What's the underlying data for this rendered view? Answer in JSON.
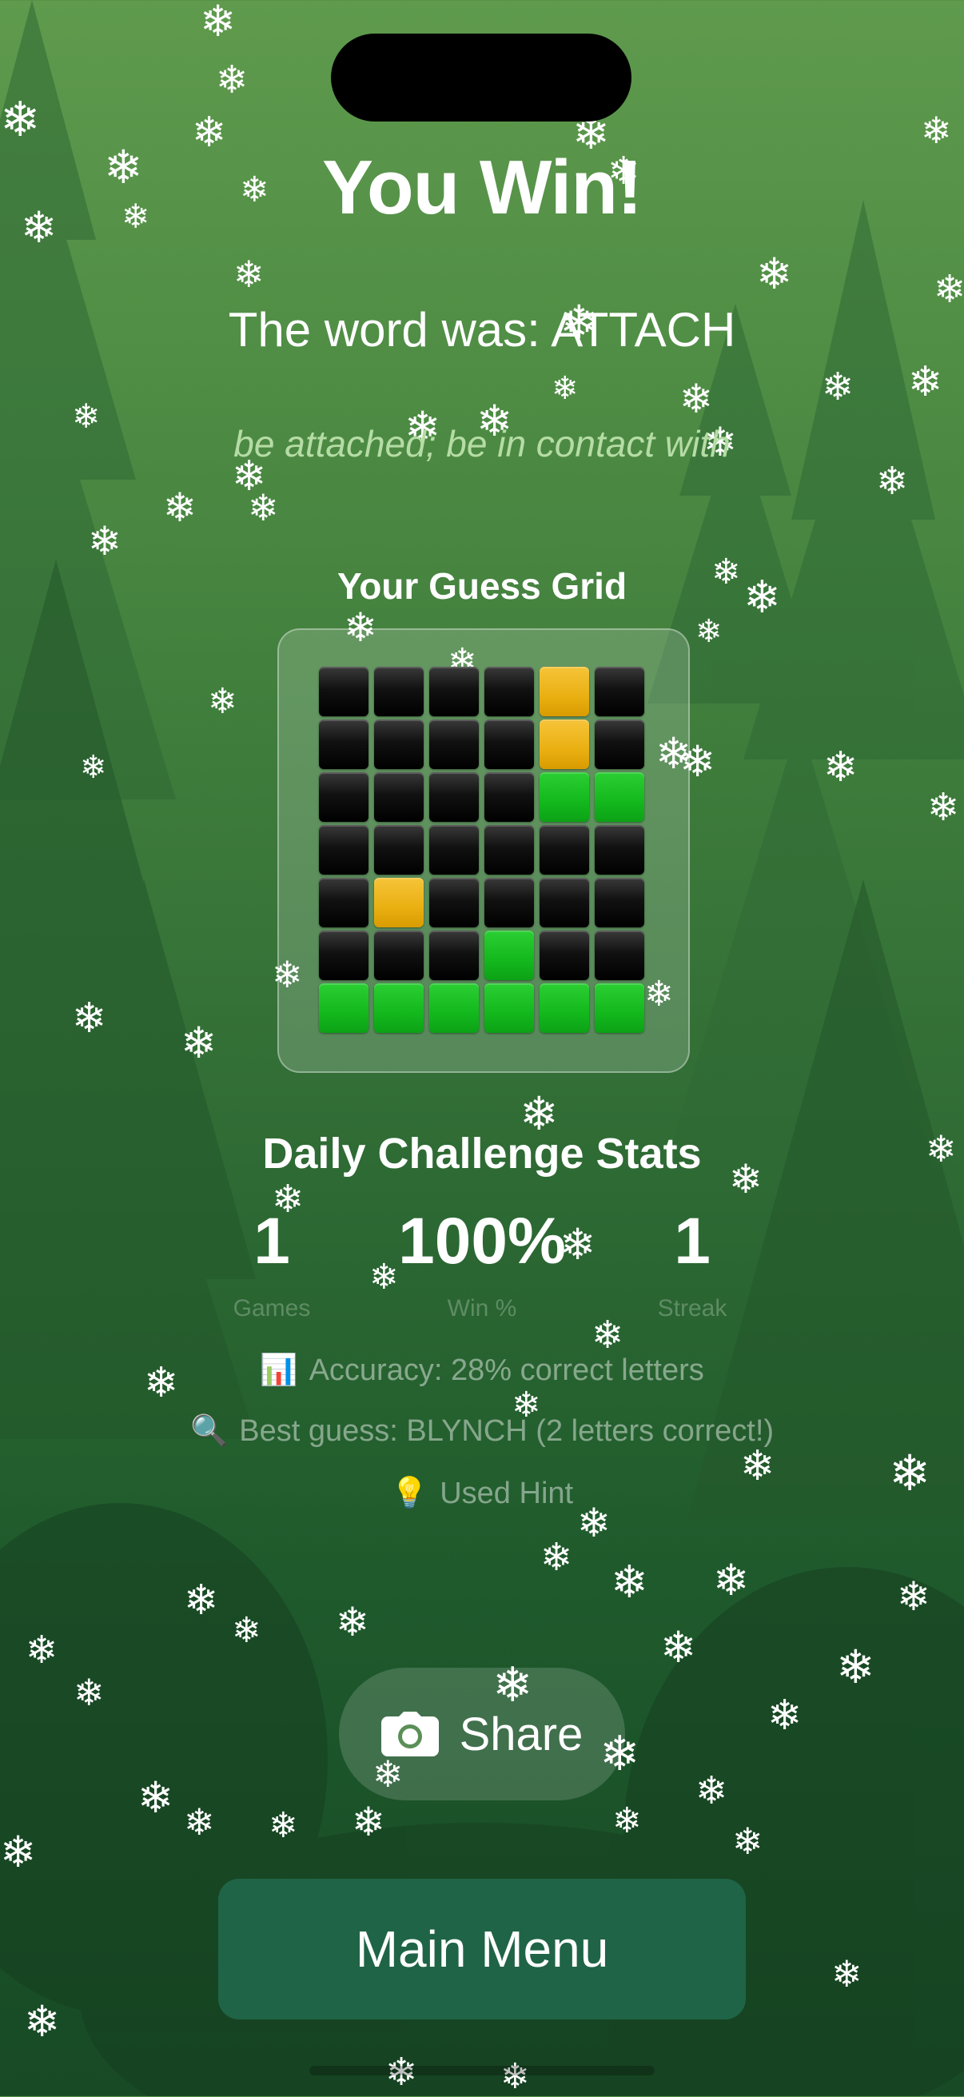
{
  "title": "You Win!",
  "word_line": "The word was: ATTACH",
  "definition": "be attached; be in contact with",
  "grid": {
    "title": "Your Guess Grid",
    "rows": [
      [
        "b",
        "b",
        "b",
        "b",
        "y",
        "b"
      ],
      [
        "b",
        "b",
        "b",
        "b",
        "y",
        "b"
      ],
      [
        "b",
        "b",
        "b",
        "b",
        "g",
        "g"
      ],
      [
        "b",
        "b",
        "b",
        "b",
        "b",
        "b"
      ],
      [
        "b",
        "y",
        "b",
        "b",
        "b",
        "b"
      ],
      [
        "b",
        "b",
        "b",
        "g",
        "b",
        "b"
      ],
      [
        "g",
        "g",
        "g",
        "g",
        "g",
        "g"
      ]
    ]
  },
  "stats": {
    "title": "Daily Challenge Stats",
    "items": [
      {
        "value": "1",
        "label": "Games"
      },
      {
        "value": "100%",
        "label": "Win %"
      },
      {
        "value": "1",
        "label": "Streak"
      }
    ]
  },
  "info": {
    "accuracy": {
      "icon": "bar-chart-icon",
      "emoji": "📊",
      "text": "Accuracy: 28% correct letters"
    },
    "best_guess": {
      "icon": "magnifying-glass-icon",
      "emoji": "🔍",
      "text": "Best guess: BLYNCH (2 letters correct!)"
    },
    "hint": {
      "icon": "light-bulb-icon",
      "emoji": "💡",
      "text": "Used Hint"
    }
  },
  "buttons": {
    "share_label": "Share",
    "share_icon": "camera-icon",
    "main_menu_label": "Main Menu"
  },
  "colors": {
    "accent_green": "#1f6446",
    "tile_yellow": "#eab012",
    "tile_green": "#13b81d",
    "tile_black": "#111111"
  }
}
